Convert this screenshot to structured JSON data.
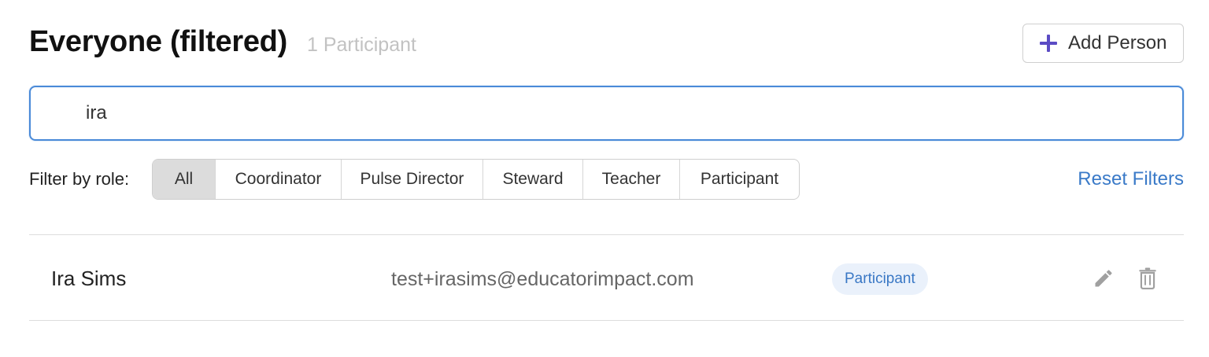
{
  "header": {
    "title": "Everyone (filtered)",
    "count": "1 Participant",
    "add_button": {
      "label": "Add Person",
      "icon": "plus-icon"
    }
  },
  "search": {
    "value": "ira",
    "icon": "search-icon"
  },
  "filters": {
    "label": "Filter by role:",
    "roles": [
      "All",
      "Coordinator",
      "Pulse Director",
      "Steward",
      "Teacher",
      "Participant"
    ],
    "selected": "All",
    "reset_label": "Reset Filters"
  },
  "people": [
    {
      "name": "Ira Sims",
      "email": "test+irasims@educatorimpact.com",
      "role": "Participant",
      "actions": [
        "pencil-icon",
        "trash-icon"
      ]
    }
  ],
  "colors": {
    "accent_plus": "#5b4bc4",
    "focus_border": "#4a8ad8",
    "link": "#3a7ac8",
    "badge_bg": "#eaf1fb",
    "badge_text": "#3a78c5",
    "active_segment": "#dcdcdc",
    "muted_count": "#c2c2c2",
    "icon_gray": "#a0a0a0"
  }
}
